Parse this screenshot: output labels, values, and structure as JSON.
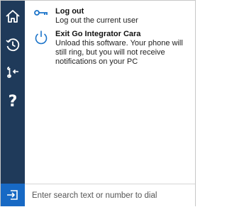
{
  "sidebar": {
    "items": [
      {
        "name": "home",
        "icon": "home-icon"
      },
      {
        "name": "history",
        "icon": "history-clock-icon"
      },
      {
        "name": "transfer",
        "icon": "phone-transfer-icon"
      },
      {
        "name": "help",
        "icon": "help-icon",
        "glyph": "?"
      }
    ],
    "exit_icon": "sign-in-arrow-icon"
  },
  "menu": {
    "items": [
      {
        "title": "Log out",
        "description": "Log out the current user",
        "icon": "key-icon"
      },
      {
        "title": "Exit Go Integrator Cara",
        "description": "Unload this software. Your phone will still ring, but you will not receive notifications on your PC",
        "icon": "power-icon"
      }
    ]
  },
  "search": {
    "placeholder": "Enter search text or number to dial",
    "value": ""
  },
  "colors": {
    "sidebar": "#1f3a5a",
    "accent": "#1769c4",
    "icon_blue": "#1a73c9"
  }
}
